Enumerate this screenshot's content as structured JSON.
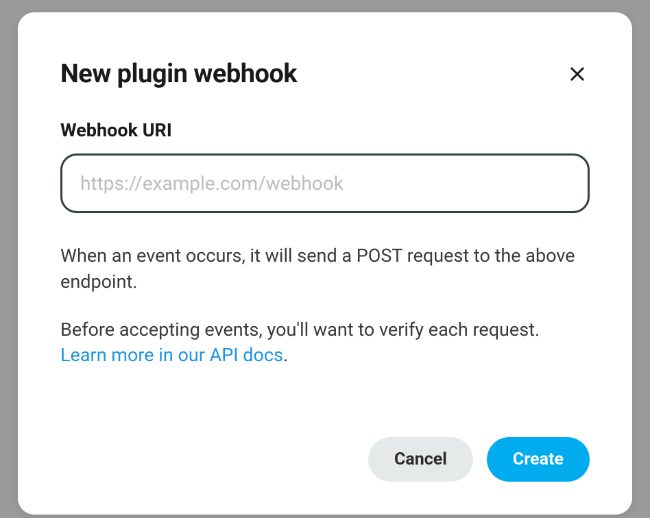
{
  "modal": {
    "title": "New plugin webhook",
    "field_label": "Webhook URI",
    "input_placeholder": "https://example.com/webhook",
    "input_value": "",
    "help_paragraph_1": "When an event occurs, it will send a POST request to the above endpoint.",
    "help_paragraph_2_prefix": "Before accepting events, you'll want to verify each request. ",
    "help_link_text": "Learn more in our API docs",
    "help_paragraph_2_suffix": ".",
    "cancel_label": "Cancel",
    "create_label": "Create"
  },
  "colors": {
    "accent": "#00acee",
    "link": "#1b95e0",
    "input_border": "#344148",
    "cancel_bg": "#e6e9ea"
  }
}
